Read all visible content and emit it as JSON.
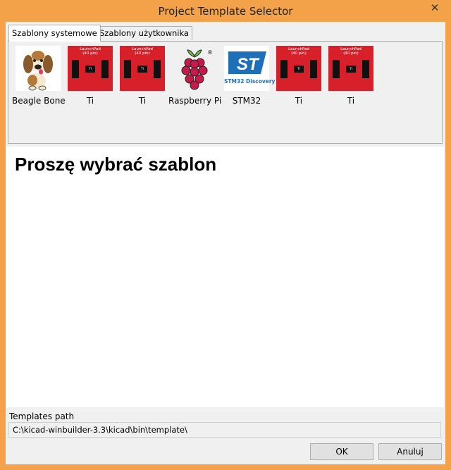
{
  "window": {
    "title": "Project Template Selector",
    "close_glyph": "✕"
  },
  "tabs": [
    {
      "label": "Szablony systemowe",
      "active": true
    },
    {
      "label": "Szablony użytkownika",
      "active": false
    }
  ],
  "templates": [
    {
      "label": "Beagle Bone",
      "icon": "beagle-dog-icon"
    },
    {
      "label": "Ti",
      "icon": "ti-launchpad-icon",
      "thumb_line1": "LaunchPad",
      "thumb_line2": "(40 pin)"
    },
    {
      "label": "Ti",
      "icon": "ti-launchpad-icon",
      "thumb_line1": "LaunchPad",
      "thumb_line2": "(40 pin)"
    },
    {
      "label": "Raspberry Pi",
      "icon": "raspberry-icon"
    },
    {
      "label": "STM32",
      "icon": "st-logo-icon",
      "thumb_caption": "STM32 Discovery"
    },
    {
      "label": "Ti",
      "icon": "ti-launchpad-icon",
      "thumb_line1": "LaunchPad",
      "thumb_line2": "(40 pin)"
    },
    {
      "label": "Ti",
      "icon": "ti-launchpad-icon",
      "thumb_line1": "LaunchPad",
      "thumb_line2": "(40 pin)"
    }
  ],
  "description": {
    "heading": "Proszę wybrać szablon"
  },
  "path": {
    "label": "Templates path",
    "value": "C:\\kicad-winbuilder-3.3\\kicad\\bin\\template\\"
  },
  "buttons": {
    "ok": "OK",
    "cancel": "Anuluj"
  },
  "colors": {
    "title_bar": "#f4a24a",
    "ti_red": "#d8202a",
    "rpi_red": "#c51a4a",
    "st_blue": "#1d6fb8"
  }
}
